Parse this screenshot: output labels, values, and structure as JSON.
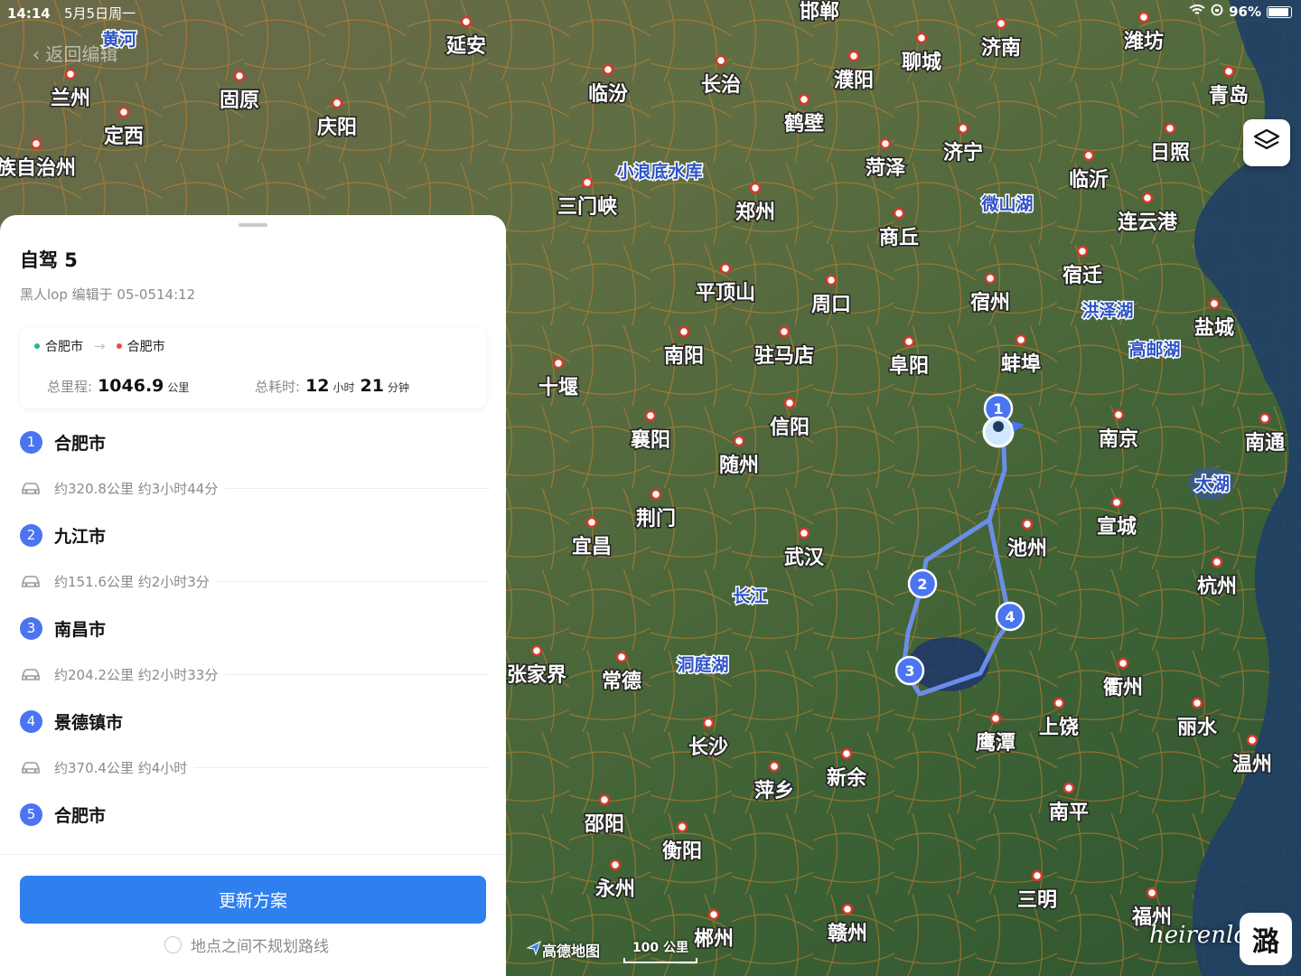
{
  "status_bar": {
    "time": "14:14",
    "date": "5月5日周一",
    "battery": "96%",
    "battery_fraction": 0.96
  },
  "back_label": "返回编辑",
  "map": {
    "cities": [
      "邯郸",
      "济南",
      "潍坊",
      "黄河",
      "延安",
      "兰州",
      "固原",
      "庆阳",
      "长治",
      "濮阳",
      "聊城",
      "青岛",
      "临汾",
      "鹤壁",
      "日照",
      "定西",
      "族自治州",
      "小浪底水库",
      "菏泽",
      "济宁",
      "临沂",
      "三门峡",
      "郑州",
      "微山湖",
      "连云港",
      "商丘",
      "宿迁",
      "平顶山",
      "周口",
      "宿州",
      "洪泽湖",
      "盐城",
      "高邮湖",
      "南阳",
      "驻马店",
      "阜阳",
      "蚌埠",
      "十堰",
      "信阳",
      "南京",
      "南通",
      "襄阳",
      "随州",
      "太湖",
      "荆门",
      "宣城",
      "宜昌",
      "武汉",
      "池州",
      "杭州",
      "长江",
      "洞庭湖",
      "张家界",
      "常德",
      "衢州",
      "鹰潭",
      "上饶",
      "丽水",
      "长沙",
      "温州",
      "新余",
      "萍乡",
      "南平",
      "邵阳",
      "衡阳",
      "三明",
      "永州",
      "福州",
      "郴州",
      "赣州"
    ],
    "route_markers": [
      "1",
      "2",
      "3",
      "4"
    ],
    "logo": "高德地图",
    "scale": "100 公里"
  },
  "panel": {
    "title": "自驾 5",
    "meta": "黑人lop 编辑于 05-0514:12",
    "origin": "合肥市",
    "destination": "合肥市",
    "distance_label": "总里程:",
    "distance_value": "1046.9",
    "distance_unit": "公里",
    "time_label": "总耗时:",
    "hours": "12",
    "hours_unit": "小时",
    "minutes": "21",
    "minutes_unit": "分钟",
    "waypoints": [
      {
        "num": "1",
        "name": "合肥市"
      },
      {
        "num": "2",
        "name": "九江市"
      },
      {
        "num": "3",
        "name": "南昌市"
      },
      {
        "num": "4",
        "name": "景德镇市"
      },
      {
        "num": "5",
        "name": "合肥市"
      }
    ],
    "legs": [
      {
        "text": "约320.8公里 约3小时44分"
      },
      {
        "text": "约151.6公里 约2小时3分"
      },
      {
        "text": "约204.2公里 约2小时33分"
      },
      {
        "text": "约370.4公里 约4小时"
      }
    ],
    "update_button": "更新方案",
    "no_route_option": "地点之间不规划路线"
  },
  "watermark": "heirenlop",
  "seal_char": "潞",
  "colors": {
    "accent": "#2f80ee",
    "waypoint": "#4a74f0",
    "route": "#6f8ff0",
    "origin_dot": "#1fb89a",
    "dest_dot": "#f04a3a"
  }
}
